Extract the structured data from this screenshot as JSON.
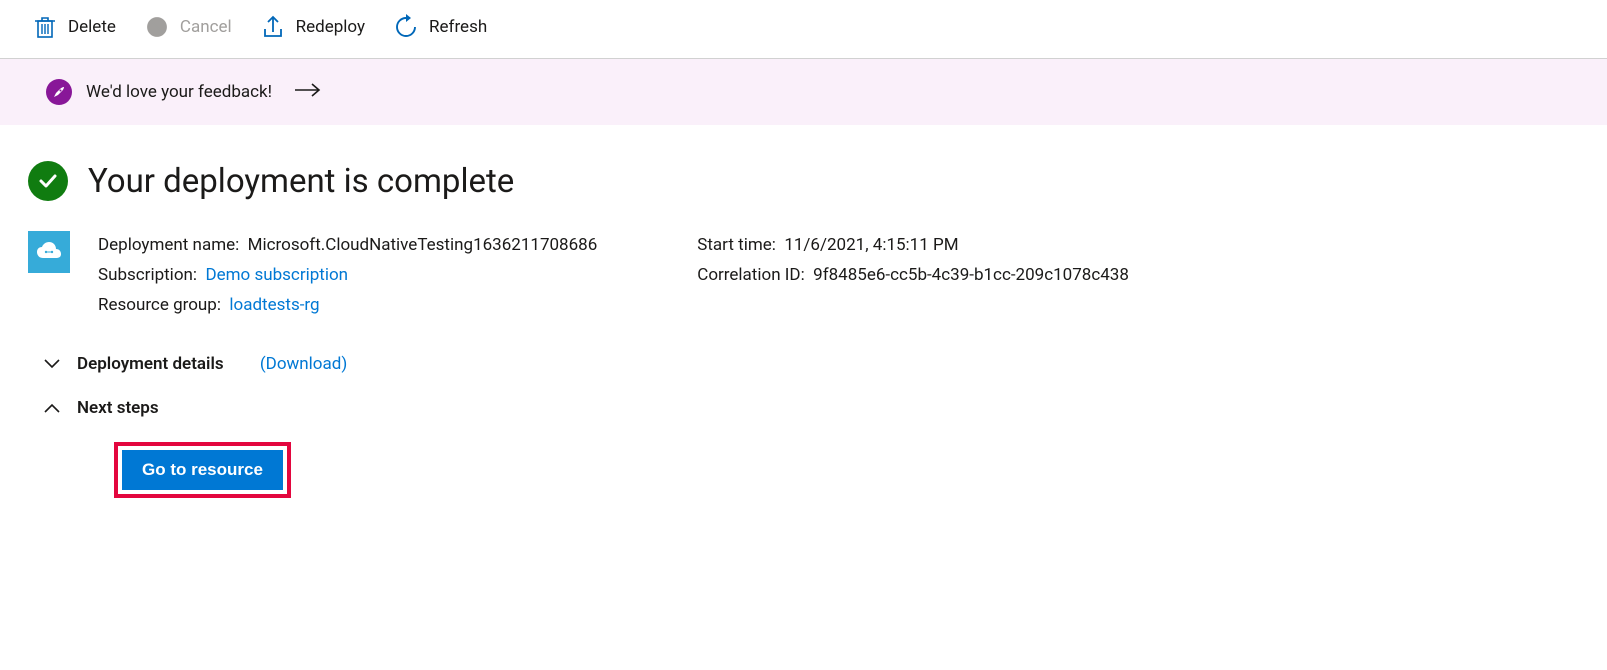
{
  "toolbar": {
    "delete": "Delete",
    "cancel": "Cancel",
    "redeploy": "Redeploy",
    "refresh": "Refresh"
  },
  "banner": {
    "feedback": "We'd love your feedback!"
  },
  "title": "Your deployment is complete",
  "details": {
    "deployment_name_label": "Deployment name:",
    "deployment_name_value": "Microsoft.CloudNativeTesting1636211708686",
    "subscription_label": "Subscription:",
    "subscription_value": "Demo subscription",
    "resource_group_label": "Resource group:",
    "resource_group_value": "loadtests-rg",
    "start_time_label": "Start time:",
    "start_time_value": "11/6/2021, 4:15:11 PM",
    "correlation_id_label": "Correlation ID:",
    "correlation_id_value": "9f8485e6-cc5b-4c39-b1cc-209c1078c438"
  },
  "expanders": {
    "deployment_details": "Deployment details",
    "download": "(Download)",
    "next_steps": "Next steps"
  },
  "button": {
    "go_to_resource": "Go to resource"
  }
}
